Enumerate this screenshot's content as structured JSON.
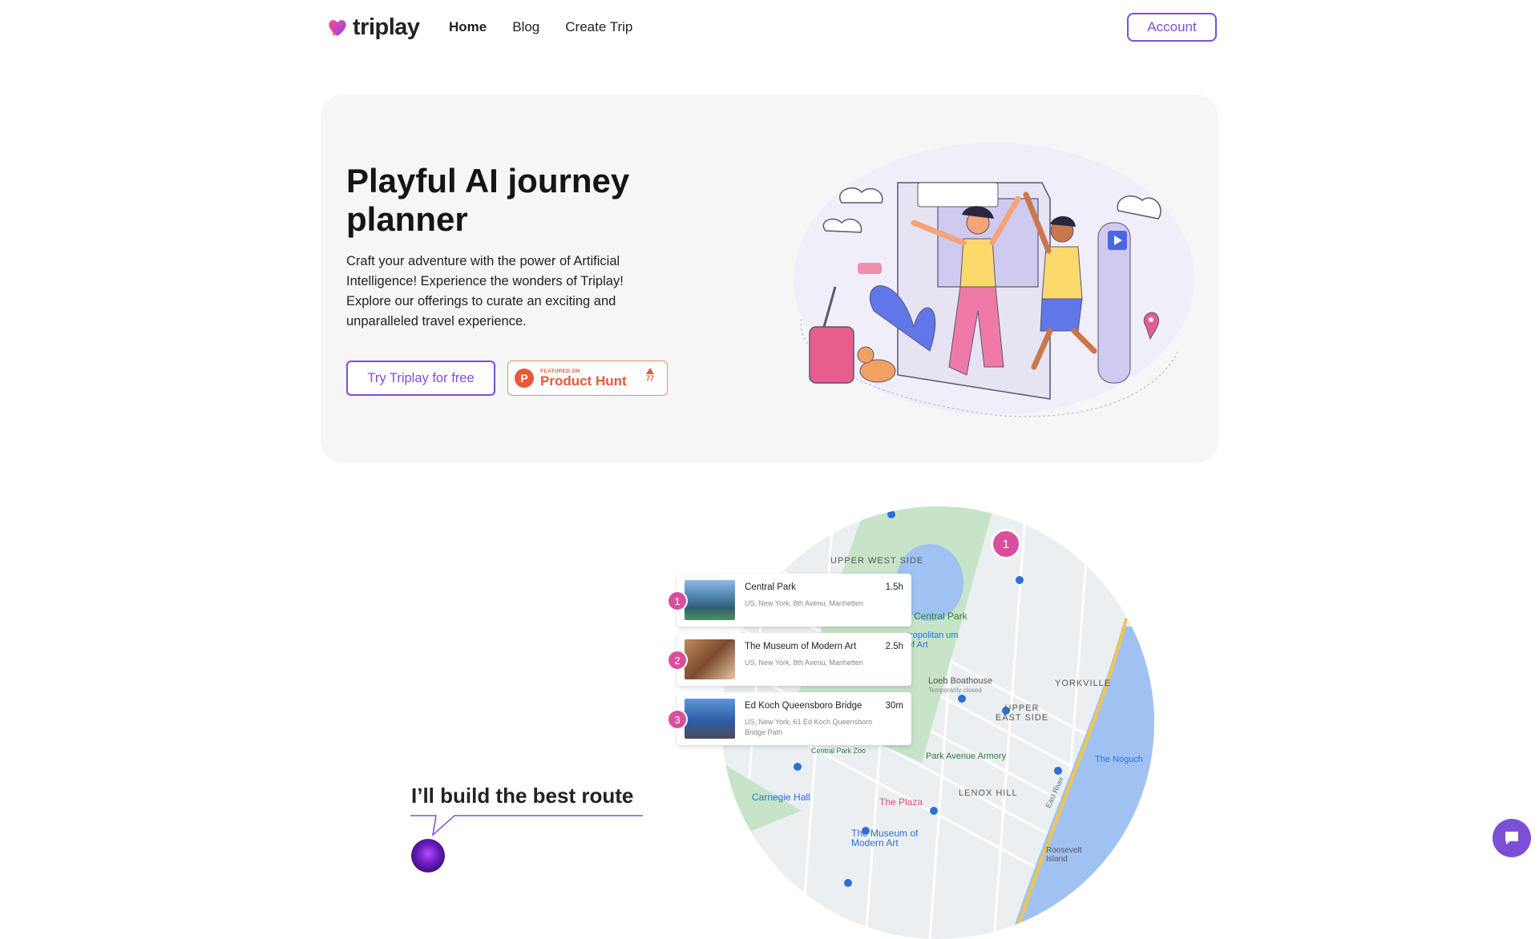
{
  "nav": {
    "logo_text": "triplay",
    "links": [
      {
        "label": "Home",
        "active": true
      },
      {
        "label": "Blog",
        "active": false
      },
      {
        "label": "Create Trip",
        "active": false
      }
    ],
    "account_label": "Account"
  },
  "hero": {
    "title": "Playful AI journey planner",
    "description": "Craft your adventure with the power of Artificial Intelligence! Experience the wonders of Triplay! Explore our offerings to curate an exciting and unparalleled travel experience.",
    "cta_label": "Try Triplay for free",
    "product_hunt": {
      "featured_label": "FEATURED ON",
      "name": "Product Hunt",
      "upvotes": "77"
    }
  },
  "route": {
    "map_pin_number": "1",
    "stops": [
      {
        "number": "1",
        "name": "Central Park",
        "duration": "1.5h",
        "address": "US, New York, 8th Avenu, Manhetten"
      },
      {
        "number": "2",
        "name": "The Museum of Modern Art",
        "duration": "2.5h",
        "address": "US, New York, 8th Avenu, Manhetten"
      },
      {
        "number": "3",
        "name": "Ed Koch Queensboro Bridge",
        "duration": "30m",
        "address": "US, New York, 61 Ed Koch Queensboro Bridge Path"
      }
    ],
    "map_labels": {
      "upper_west_side": "UPPER WEST SIDE",
      "central_park": "Central Park",
      "met": "tropolitan um of Art",
      "boathouse": "Loeb Boathouse",
      "boathouse_status": "Temporarily closed",
      "yorkville": "YORKVILLE",
      "upper_east_side": "UPPER EAST SIDE",
      "park_avenue_armory": "Park Avenue Armory",
      "lenox_hill": "LENOX HILL",
      "carnegie_hall": "Carnegie Hall",
      "the_plaza": "The Plaza",
      "moma": "The Museum of Modern Art",
      "noguchi": "The Noguch",
      "roosevelt": "Roosevelt Island",
      "east_river": "East River",
      "central_park_zoo": "Central Park Zoo"
    },
    "bubble_text": "I’ll build the best route"
  },
  "colors": {
    "accent": "#7b4fd6",
    "pink": "#d94f9e",
    "product_hunt": "#e8583a",
    "hero_bg": "#f6f6f7"
  },
  "icons": {
    "logo": "heart-logo-icon",
    "chat": "chat-bubble-icon",
    "upvote": "upvote-triangle-icon"
  }
}
